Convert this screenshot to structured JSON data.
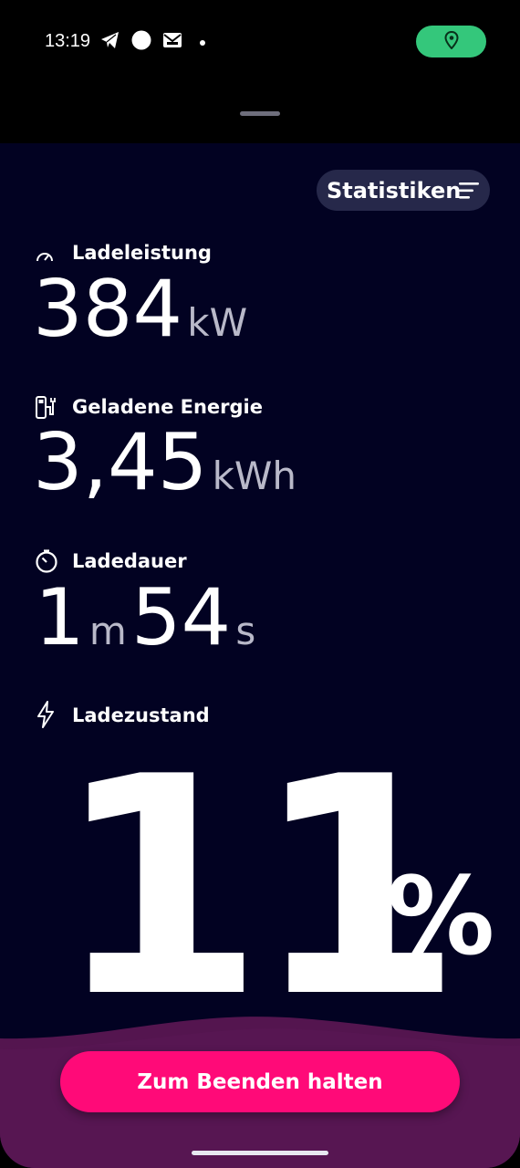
{
  "status_bar": {
    "time": "13:19",
    "icons": [
      "telegram-icon",
      "circle-notification-icon",
      "mail-icon",
      "dot-icon"
    ],
    "location_pill_color": "#34c77b"
  },
  "header": {
    "statistics_label": "Statistiken"
  },
  "metrics": {
    "power": {
      "label": "Ladeleistung",
      "value": "384",
      "unit": "kW",
      "icon": "speedometer-icon"
    },
    "energy": {
      "label": "Geladene Energie",
      "value": "3,45",
      "unit": "kWh",
      "icon": "charger-station-icon"
    },
    "duration": {
      "label": "Ladedauer",
      "minutes": "1",
      "minutes_unit": "m",
      "seconds": "54",
      "seconds_unit": "s",
      "icon": "timer-icon"
    },
    "soc": {
      "label": "Ladezustand",
      "value": "11",
      "unit": "%",
      "icon": "lightning-icon"
    }
  },
  "action": {
    "end_label": "Zum Beenden halten",
    "color": "#ff0a78"
  },
  "colors": {
    "background": "#020222",
    "wave": "#54154f",
    "pill": "#26284a"
  }
}
